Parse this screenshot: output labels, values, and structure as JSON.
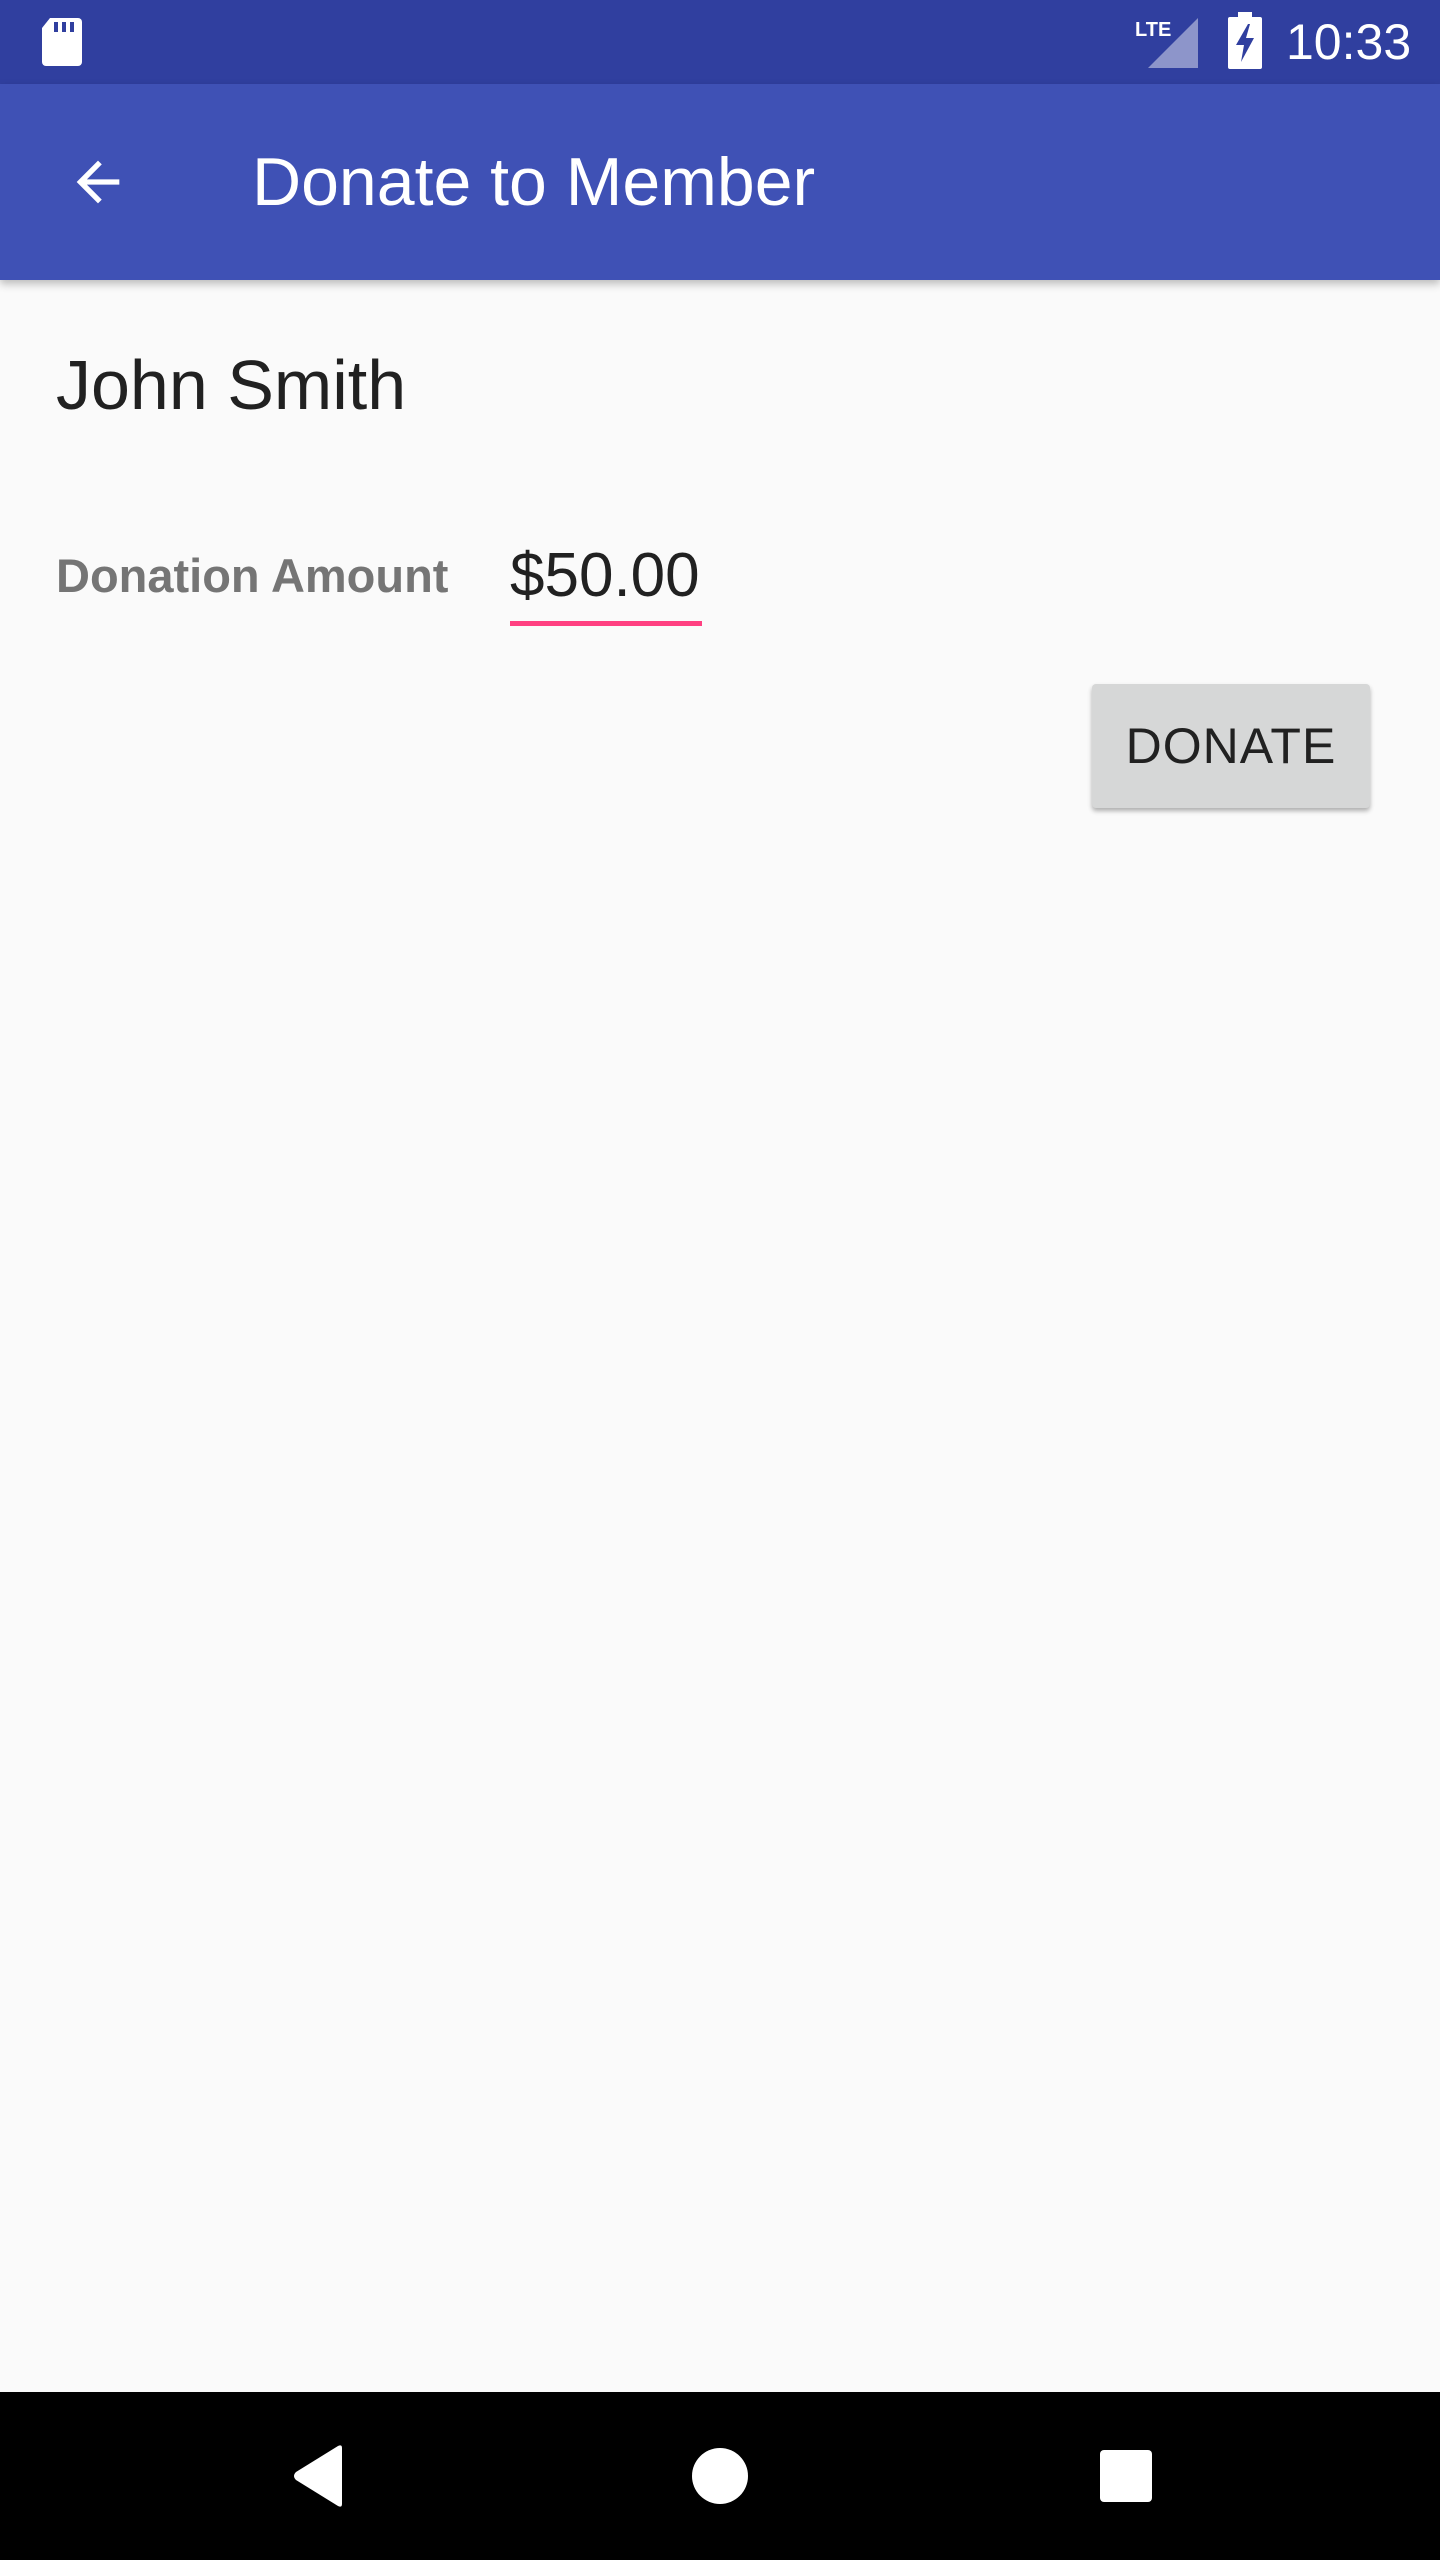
{
  "status_bar": {
    "time": "10:33",
    "network": "LTE",
    "icons": [
      "sd-card-icon",
      "lte-signal-icon",
      "battery-charging-icon"
    ]
  },
  "app_bar": {
    "title": "Donate to Member",
    "back_icon": "arrow-back-icon",
    "color": "#3f51b5",
    "status_color": "#303f9f"
  },
  "content": {
    "member_name": "John Smith",
    "amount_label": "Donation Amount",
    "amount_value": "$50.00",
    "donate_button": "DONATE",
    "accent_color": "#ff4081"
  },
  "nav_bar": {
    "icons": [
      "nav-back-icon",
      "nav-home-icon",
      "nav-recents-icon"
    ]
  }
}
